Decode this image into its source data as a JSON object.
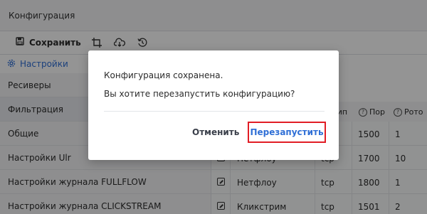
{
  "app": {
    "title": "Конфигурация"
  },
  "toolbar": {
    "save_label": "Сохранить",
    "icons": [
      "save-icon",
      "crop-icon",
      "cloud-download-icon",
      "history-icon"
    ]
  },
  "sidebar": {
    "header": "Настройки",
    "items": [
      {
        "label": "Ресиверы"
      },
      {
        "label": "Фильтрация"
      },
      {
        "label": "Общие"
      },
      {
        "label": "Настройки Ulr"
      },
      {
        "label": "Настройки журнала FULLFLOW"
      },
      {
        "label": "Настройки журнала CLICKSTREAM"
      }
    ]
  },
  "table": {
    "columns": [
      "Тип",
      "Пор",
      "Рото"
    ],
    "rows": [
      {
        "name": "",
        "type": "",
        "port": "1500",
        "rot": "1"
      },
      {
        "name": "Нетфлоу",
        "type": "tcp",
        "port": "1700",
        "rot": "10"
      },
      {
        "name": "Нетфлоу",
        "type": "tcp",
        "port": "1800",
        "rot": "1"
      },
      {
        "name": "Кликстрим",
        "type": "tcp",
        "port": "1501",
        "rot": "2"
      }
    ]
  },
  "dialog": {
    "message": "Конфигурация сохранена.",
    "question": "Вы хотите перезапустить конфигурацию?",
    "cancel_label": "Отменить",
    "confirm_label": "Перезапустить"
  },
  "colors": {
    "accent": "#2f6fd6",
    "highlight": "#e11d25",
    "overlay": "rgba(0,0,0,0.42)"
  }
}
